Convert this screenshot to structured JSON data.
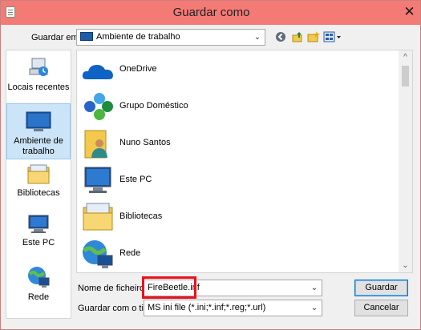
{
  "window": {
    "title": "Guardar como",
    "close_glyph": "✕",
    "app_icon": "notepad-icon"
  },
  "location": {
    "label": "Guardar em:",
    "value": "Ambiente de trabalho",
    "icon": "desktop-icon"
  },
  "toolbar": {
    "back_icon": "back-icon",
    "up_icon": "up-folder-icon",
    "new_folder_icon": "new-folder-icon",
    "view_icon": "view-menu-icon"
  },
  "places": [
    {
      "label": "Locais recentes",
      "icon": "recent-places-icon",
      "selected": false
    },
    {
      "label": "Ambiente de trabalho",
      "icon": "desktop-icon",
      "selected": true
    },
    {
      "label": "Bibliotecas",
      "icon": "libraries-icon",
      "selected": false
    },
    {
      "label": "Este PC",
      "icon": "computer-icon",
      "selected": false
    },
    {
      "label": "Rede",
      "icon": "network-icon",
      "selected": false
    }
  ],
  "files": [
    {
      "name": "OneDrive",
      "icon": "onedrive-icon"
    },
    {
      "name": "Grupo Doméstico",
      "icon": "homegroup-icon"
    },
    {
      "name": "Nuno Santos",
      "icon": "user-folder-icon"
    },
    {
      "name": "Este PC",
      "icon": "computer-icon"
    },
    {
      "name": "Bibliotecas",
      "icon": "libraries-icon"
    },
    {
      "name": "Rede",
      "icon": "network-icon"
    }
  ],
  "filename": {
    "label": "Nome de ficheiro:",
    "value": "FireBeetle.inf"
  },
  "filetype": {
    "label": "Guardar com o tipo:",
    "value": "MS ini file (*.ini;*.inf;*.reg;*.url)"
  },
  "buttons": {
    "save": "Guardar",
    "cancel": "Cancelar"
  },
  "colors": {
    "titlebar": "#f47a76",
    "selection": "#cce4f7",
    "highlight": "#e8121c",
    "default_button_border": "#0078d7"
  },
  "scroll": {
    "up": "^",
    "down": "⌄"
  }
}
